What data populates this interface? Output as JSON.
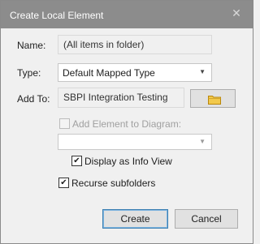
{
  "dialog": {
    "title": "Create Local Element",
    "close_glyph": "✕"
  },
  "form": {
    "name": {
      "label": "Name:",
      "value": "(All items in folder)"
    },
    "type": {
      "label": "Type:",
      "value": "Default Mapped Type"
    },
    "add_to": {
      "label": "Add To:",
      "value": "SBPI Integration Testing",
      "browse_icon": "folder-icon"
    },
    "add_element_to_diagram": {
      "label": "Add Element to Diagram:",
      "checked": false,
      "disabled": true
    },
    "diagram_select": {
      "value": ""
    },
    "display_as_info_view": {
      "label": "Display as Info View",
      "checked": true
    },
    "recurse_subfolders": {
      "label": "Recurse subfolders",
      "checked": true
    }
  },
  "buttons": {
    "create": "Create",
    "cancel": "Cancel"
  },
  "colors": {
    "title_bar": "#8c8c8c",
    "primary_border": "#3c7fb1",
    "folder": "#f2c94c"
  }
}
